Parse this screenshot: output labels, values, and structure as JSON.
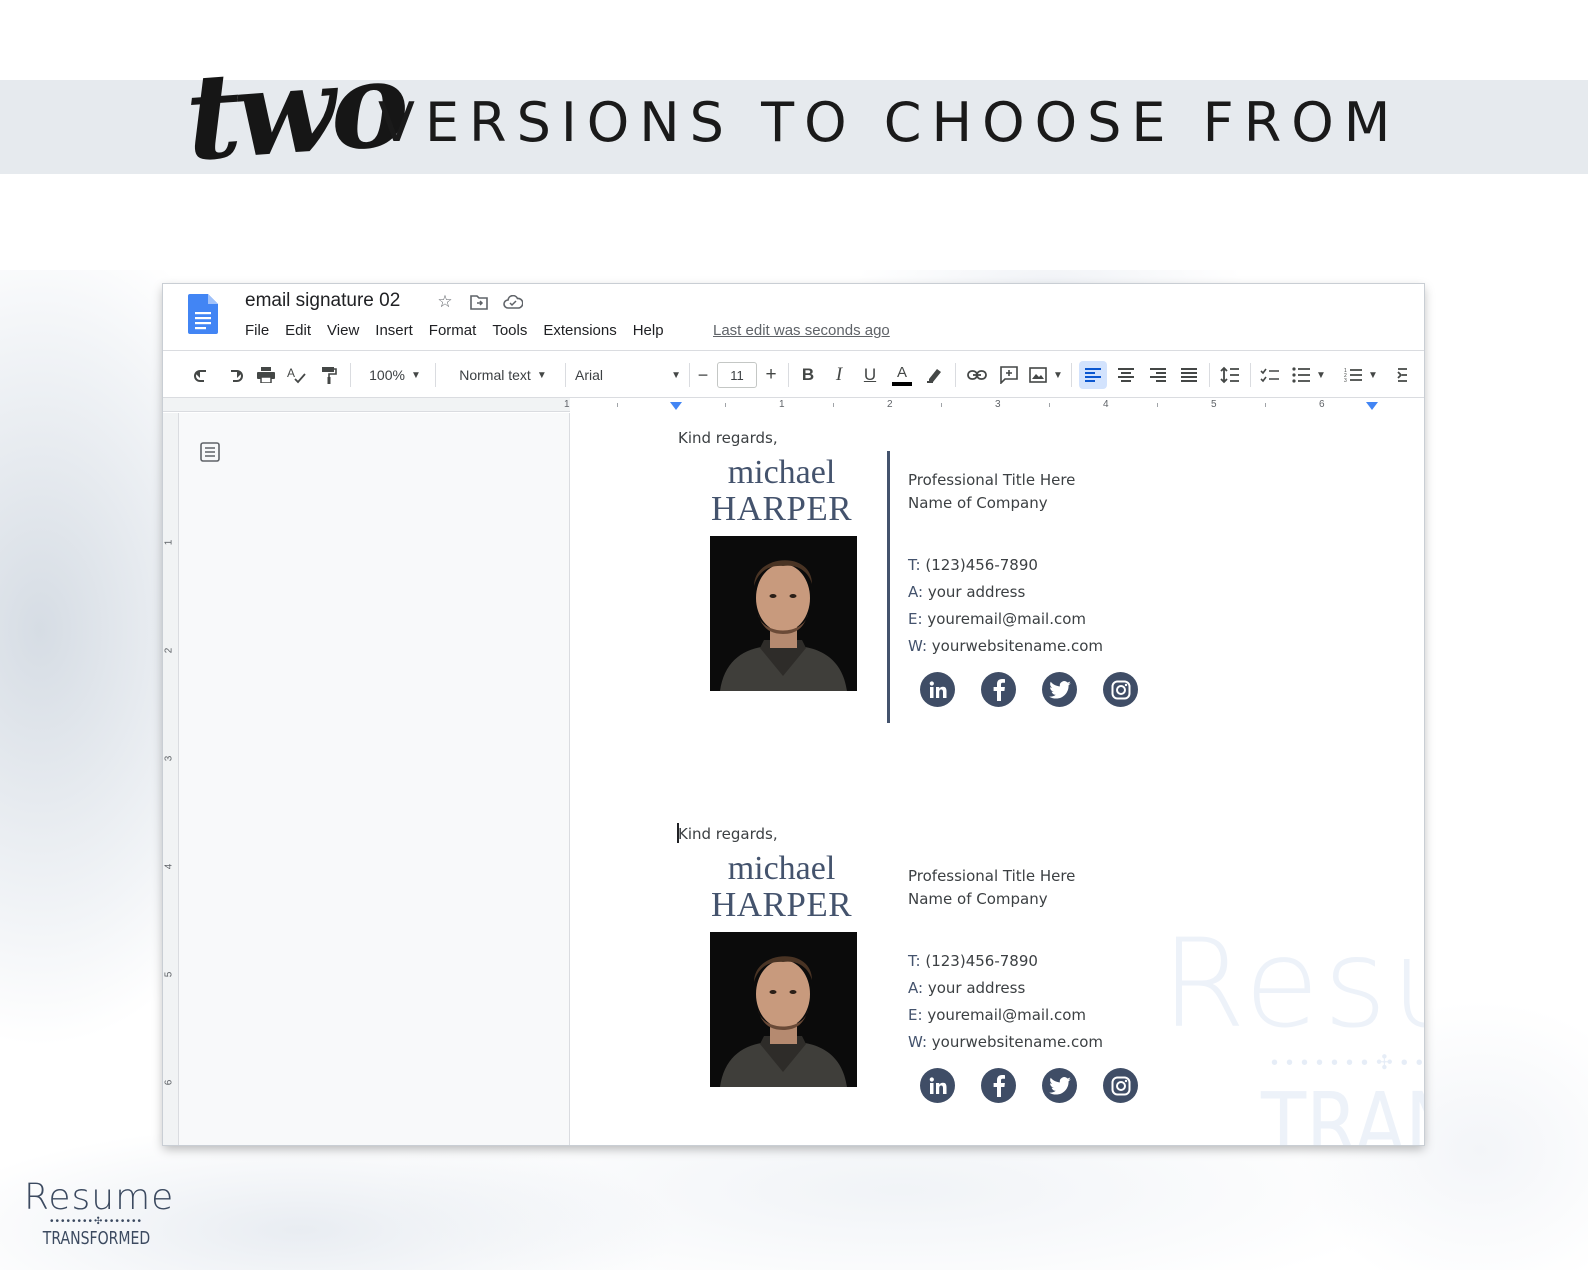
{
  "banner": {
    "script_word": "two",
    "headline": "VERSIONS TO CHOOSE FROM"
  },
  "doc": {
    "title": "email signature 02",
    "title_icons": [
      "star-icon",
      "move-folder-icon",
      "cloud-status-icon"
    ],
    "menu": [
      "File",
      "Edit",
      "View",
      "Insert",
      "Format",
      "Tools",
      "Extensions",
      "Help"
    ],
    "last_edit": "Last edit was seconds ago"
  },
  "toolbar": {
    "zoom": "100%",
    "style": "Normal text",
    "font": "Arial",
    "font_size": "11",
    "minus": "−",
    "plus": "+"
  },
  "ruler": {
    "horizontal": [
      "1",
      "1",
      "2",
      "3",
      "4",
      "5",
      "6"
    ],
    "vertical": [
      "1",
      "2",
      "3",
      "4",
      "5",
      "6"
    ]
  },
  "signatures": [
    {
      "greeting": "Kind regards,",
      "first_name": "michael",
      "last_name": "HARPER",
      "title": "Professional Title Here",
      "company": "Name of Company",
      "phone_label": "T:",
      "phone": "(123)456-7890",
      "address_label": "A:",
      "address": "your address",
      "email_label": "E:",
      "email": "youremail@mail.com",
      "web_label": "W:",
      "web": "yourwebsitename.com",
      "socials": [
        "linkedin-icon",
        "facebook-icon",
        "twitter-icon",
        "instagram-icon"
      ]
    },
    {
      "greeting": "Kind regards,",
      "first_name": "michael",
      "last_name": "HARPER",
      "title": "Professional Title Here",
      "company": "Name of Company",
      "phone_label": "T:",
      "phone": "(123)456-7890",
      "address_label": "A:",
      "address": "your address",
      "email_label": "E:",
      "email": "youremail@mail.com",
      "web_label": "W:",
      "web": "yourwebsitename.com",
      "socials": [
        "linkedin-icon",
        "facebook-icon",
        "twitter-icon",
        "instagram-icon"
      ]
    }
  ],
  "watermark": {
    "line1": "Resume",
    "line2": "TRANSFORMED"
  },
  "brand": {
    "line1": "Resume",
    "dots": "••••••••✣•••••••",
    "line2": "TRANSFORMED"
  },
  "colors": {
    "accent_navy": "#44536d",
    "banner_bg": "#e6eaee",
    "docs_blue": "#4285f4"
  }
}
